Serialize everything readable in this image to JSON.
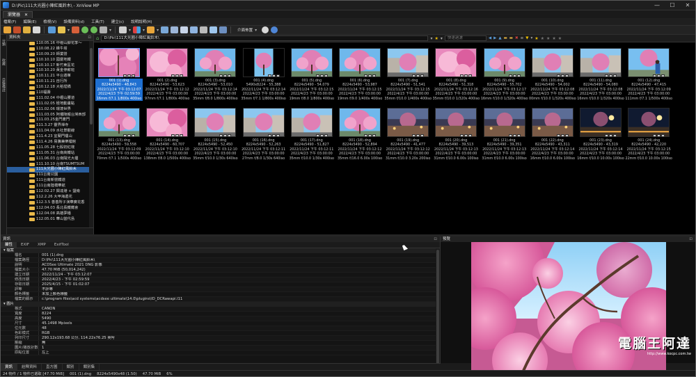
{
  "window": {
    "title": "D:\\Pic\\111大光圈小陣紅風鈴木\\ - XnView MP",
    "min": "—",
    "max": "☐",
    "close": "✕"
  },
  "tab": {
    "label": "瀏覽器",
    "close": "✕"
  },
  "menu": [
    "檔案(F)",
    "編輯(E)",
    "檢視(V)",
    "設備資料(d)",
    "工具(T)",
    "建立(c)",
    "說明說明(H)"
  ],
  "toolbar": {
    "layout_label": "介面佈置",
    "icons": [
      "open-icon",
      "browse-icon",
      "folder-icon",
      "copy-icon",
      "move-icon",
      "cut-icon",
      "rotate-left-icon",
      "rotate-right-icon",
      "slideshow-icon",
      "view-mode-icon",
      "thumbnails-icon",
      "sort-icon",
      "adjust-icon",
      "find-icon",
      "compare-icon",
      "print-icon",
      "scan-icon",
      "batch-icon",
      "settings-icon",
      "help-icon"
    ]
  },
  "left_panel": {
    "header": "資料夾",
    "vtabs": [
      "分類",
      "收藏",
      "目錄備註"
    ],
    "items": [
      {
        "label": "110.05.16 中壢山腳花季～"
      },
      {
        "label": "110.08.22 蜂牛塔"
      },
      {
        "label": "110.09.20 師業營"
      },
      {
        "label": "110.10.10 國慶地鐵"
      },
      {
        "label": "110.10.17 新竹東區花"
      },
      {
        "label": "110.10.20 黃金停薪班"
      },
      {
        "label": "110.11.21 平台選單"
      },
      {
        "label": "110.11.21 自行所"
      },
      {
        "label": "110.12.18 大稻埕橋"
      },
      {
        "label": "110福壽"
      },
      {
        "label": "111.02.04 中壢山腰道"
      },
      {
        "label": "111.02.05 極地動畫點"
      },
      {
        "label": "111.02.06 環境世界"
      },
      {
        "label": "111.03.05 阿壩陵報台灣西部"
      },
      {
        "label": "111.03.25金門廈門"
      },
      {
        "label": "111.3.27 靈界禪寺"
      },
      {
        "label": "111.04.09 水社景觀線"
      },
      {
        "label": "111.4.23 宜蘭門樓山"
      },
      {
        "label": "111.4.26 易騰兼樂樓館"
      },
      {
        "label": "111.05.28 七股初紅棧"
      },
      {
        "label": "111.05.31 台南高鐵站"
      },
      {
        "label": "111.06.03 台南陽光大樓"
      },
      {
        "label": "111.10.10 台南TSUMTSUM"
      },
      {
        "label": "111大光圈小陣紅風鈴木",
        "selected": true
      },
      {
        "label": "111台南公園"
      },
      {
        "label": "111台南新營鐵道"
      },
      {
        "label": "111台南陸橋華航"
      },
      {
        "label": "112.02.27 興達港 + 鹽南"
      },
      {
        "label": "112.2.26 大甲海邊花"
      },
      {
        "label": "112.3.5 善善所子演華廣花香"
      },
      {
        "label": "112.04.03 長北長鐵鐵會"
      },
      {
        "label": "112.04.08 高雄夢幡"
      },
      {
        "label": "112.05.01 華山當代島"
      }
    ]
  },
  "pathbar": {
    "path": "D:\\Pic\\111大光圈小陣紅風鈴木\\",
    "filter_placeholder": "快速過濾"
  },
  "thumbnails": [
    {
      "name": "001 (1).dng",
      "size": "8224x5490 - 48,843",
      "created": "2022/11/24 下午 03:12:07",
      "modified": "2022/4/23 下午 02:59:59",
      "exif": "16mm f/7.1 1/800s 400iso",
      "selected": true,
      "scene": "pink"
    },
    {
      "name": "001 (2).dng",
      "size": "8224x5490 - 53,623",
      "created": "2022/11/24 下午 03:12:12",
      "modified": "2022/4/23 下午 03:00:00",
      "exif": "97mm f/7.1 1/800s 400iso",
      "scene": "pinkclose"
    },
    {
      "name": "001 (3).dng",
      "size": "8224x5490 - 53,010",
      "created": "2022/11/24 下午 03:12:14",
      "modified": "2022/4/23 下午 03:00:00",
      "exif": "35mm f/8.0 1/800s 400iso",
      "scene": "sky"
    },
    {
      "name": "001 (4).dng",
      "size": "5490x8224 - 55,388",
      "created": "2022/11/24 下午 03:12:14",
      "modified": "2022/4/23 下午 03:00:00",
      "exif": "35mm f/7.1 1/800s 400iso",
      "scene": "portrait"
    },
    {
      "name": "001 (5).dng",
      "size": "8224x5490 - 54,079",
      "created": "2022/11/24 下午 03:12:15",
      "modified": "2022/4/23 下午 03:00:00",
      "exif": "19mm f/8.0 1/800s 400iso",
      "scene": "sky"
    },
    {
      "name": "001 (6).dng",
      "size": "8224x5490 - 53,987",
      "created": "2022/11/24 下午 03:12:15",
      "modified": "2022/4/23 下午 03:00:00",
      "exif": "19mm f/9.0 1/400s 400iso",
      "scene": "sky"
    },
    {
      "name": "001 (7).dng",
      "size": "8224x5490 - 51,541",
      "created": "2022/11/24 下午 03:12:15",
      "modified": "2022/4/23 下午 03:00:00",
      "exif": "35mm f/10.0 1/400s 400iso",
      "scene": "street"
    },
    {
      "name": "001 (8).dng",
      "size": "8224x5490 - 51,318",
      "created": "2022/11/24 下午 03:12:16",
      "modified": "2022/4/23 下午 03:00:00",
      "exif": "35mm f/10.0 1/320s 400iso",
      "scene": "pinkclose"
    },
    {
      "name": "001 (9).dng",
      "size": "8224x5490 - 55,702",
      "created": "2022/11/24 下午 03:12:17",
      "modified": "2022/4/23 下午 03:00:00",
      "exif": "16mm f/10.0 1/320s 400iso",
      "scene": "sky"
    },
    {
      "name": "001 (10).dng",
      "size": "8224x5490 - 54,002",
      "created": "2022/11/24 下午 03:12:08",
      "modified": "2022/4/23 下午 03:00:00",
      "exif": "00mm f/10.0 1/320s 400iso",
      "scene": "street"
    },
    {
      "name": "001 (11).dng",
      "size": "8224x5490 - 54,080",
      "created": "2022/11/24 下午 03:12:08",
      "modified": "2022/4/23 下午 03:00:00",
      "exif": "16mm f/10.0 1/320s 400iso",
      "scene": "street"
    },
    {
      "name": "001 (12).dng",
      "size": "8224x5490 - 47,415",
      "created": "2022/11/24 下午 03:12:09",
      "modified": "2022/4/23 下午 03:00:00",
      "exif": "111mm f/7.1 1/500s 400iso",
      "scene": "person"
    },
    {
      "name": "001 (13).dng",
      "size": "8224x5490 - 59,558",
      "created": "2022/11/24 下午 03:12:09",
      "modified": "2022/4/23 下午 03:00:00",
      "exif": "70mm f/7.1 1/500s 400iso",
      "scene": "sky"
    },
    {
      "name": "001 (14).dng",
      "size": "8224x5490 - 60,707",
      "created": "2022/11/24 下午 03:12:10",
      "modified": "2022/4/23 下午 03:00:00",
      "exif": "138mm f/8.0 1/500s 400iso",
      "scene": "pinkclose"
    },
    {
      "name": "001 (15).dng",
      "size": "8224x5490 - 52,450",
      "created": "2022/11/24 下午 03:12:10",
      "modified": "2022/4/23 下午 03:00:00",
      "exif": "35mm f/10.0 1/30s 640iso",
      "scene": "street"
    },
    {
      "name": "001 (16).dng",
      "size": "8224x5490 - 52,263",
      "created": "2022/11/24 下午 03:12:11",
      "modified": "2022/4/23 下午 03:00:00",
      "exif": "27mm f/8.0 1/30s 640iso",
      "scene": "street"
    },
    {
      "name": "001 (17).dng",
      "size": "8224x5490 - 51,827",
      "created": "2022/11/24 下午 03:12:11",
      "modified": "2022/4/23 下午 03:00:00",
      "exif": "35mm f/10.0 1/30s 400iso",
      "scene": "street"
    },
    {
      "name": "001 (18).dng",
      "size": "8224x5490 - 52,894",
      "created": "2022/11/24 下午 03:12:12",
      "modified": "2022/4/23 下午 03:00:00",
      "exif": "35mm f/16.0 6.00s 100iso",
      "scene": "sky"
    },
    {
      "name": "001 (19).dng",
      "size": "8224x5490 - 41,477",
      "created": "2022/11/24 下午 03:12:12",
      "modified": "2022/4/23 下午 03:00:00",
      "exif": "31mm f/10.0 3.20s 200iso",
      "scene": "dusk"
    },
    {
      "name": "001 (20).dng",
      "size": "8224x5490 - 39,513",
      "created": "2022/11/24 下午 03:12:13",
      "modified": "2022/4/23 下午 03:00:00",
      "exif": "31mm f/10.0 6.00s 100iso",
      "scene": "dusk"
    },
    {
      "name": "001 (21).dng",
      "size": "8224x5490 - 39,351",
      "created": "2022/11/24 下午 03:12:13",
      "modified": "2022/4/23 下午 03:00:00",
      "exif": "31mm f/10.0 6.00s 100iso",
      "scene": "dusk"
    },
    {
      "name": "001 (22).dng",
      "size": "8224x5490 - 43,311",
      "created": "2022/11/24 下午 03:12:14",
      "modified": "2022/4/23 下午 03:00:00",
      "exif": "16mm f/10.0 6.00s 100iso",
      "scene": "dusk"
    },
    {
      "name": "001 (23).dng",
      "size": "8224x5490 - 43,319",
      "created": "2022/11/24 下午 03:12:14",
      "modified": "2022/4/23 下午 03:00:00",
      "exif": "16mm f/10.0 10.00s 100iso",
      "scene": "night"
    },
    {
      "name": "001 (24).dng",
      "size": "8224x5490 - 42,220",
      "created": "2022/11/24 下午 03:12:15",
      "modified": "2022/4/23 下午 03:00:00",
      "exif": "22mm f/10.0 10.00s 100iso",
      "scene": "night"
    }
  ],
  "info": {
    "header": "資訊",
    "tabs": [
      "屬性",
      "EXIF",
      "XMP",
      "ExifTool"
    ],
    "sections": [
      {
        "title": "檔案",
        "rows": [
          [
            "檔名",
            "001 (1).dng"
          ],
          [
            "檔案路徑",
            "D:\\Pic\\111大光圈小陣紅風鈴木\\"
          ],
          [
            "說明",
            "ACDSee Ultimate 2021 DNG 影像"
          ],
          [
            "檔案大小",
            "47.70 MiB (50,014,242)"
          ],
          [
            "建立日期",
            "2022/11/24 - 下午 03:12:07"
          ],
          [
            "修改日期",
            "2022/4/23 - 下午 02:59:59"
          ],
          [
            "存取日期",
            "2025/4/15 - 下午 01:02:07"
          ],
          [
            "評等",
            "不評等"
          ],
          [
            "顏色標籤",
            "未加上顏色標籤"
          ],
          [
            "檔案的顯示",
            "c:\\program files\\acd systems\\acdsee ultimate\\14.0\\plugins\\ID_DCRawapi.l11"
          ]
        ]
      },
      {
        "title": "圖片",
        "rows": [
          [
            "格式",
            "CANON"
          ],
          [
            "寬度",
            "8224"
          ],
          [
            "高度",
            "5490"
          ],
          [
            "尺寸",
            "45.1498 Mpixels"
          ],
          [
            "位元數",
            "48"
          ],
          [
            "色彩模式",
            "RGB"
          ],
          [
            "列印尺寸",
            "290.12x193.68 公分, 114.22x76.25 英吋"
          ],
          [
            "壓縮",
            "無"
          ],
          [
            "圖片/播放計數",
            "1"
          ],
          [
            "原點位置",
            "左上"
          ]
        ]
      }
    ]
  },
  "preview": {
    "header": "預覽",
    "watermark_title": "電腦王阿達",
    "watermark_url": "http://www.kocpc.com.tw"
  },
  "bottom_tabs": [
    "資訊",
    "詮釋資料",
    "直方圖",
    "類別",
    "類別集"
  ],
  "status": {
    "text": "24 物件 / 1 物件已選取 [47.70 MiB]",
    "file": "001 (1).dng",
    "dims": "8224x5490x48 (1.50)",
    "size": "47.70 MiB",
    "zoom": "6%"
  }
}
